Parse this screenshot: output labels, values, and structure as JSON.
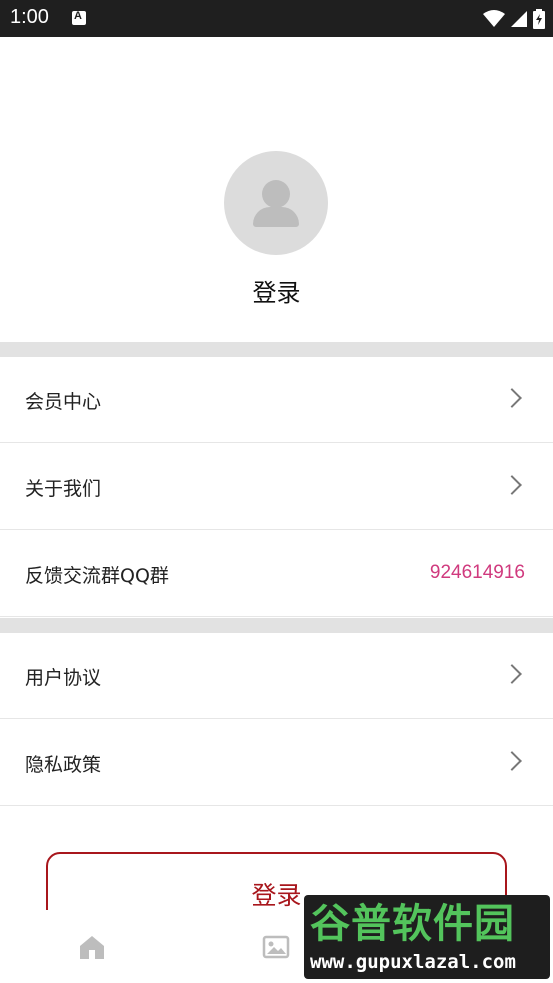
{
  "status_bar": {
    "time": "1:00"
  },
  "profile": {
    "login_text": "登录"
  },
  "menu_group_1": [
    {
      "label": "会员中心",
      "value": ""
    },
    {
      "label": "关于我们",
      "value": ""
    },
    {
      "label": "反馈交流群QQ群",
      "value": "924614916"
    }
  ],
  "menu_group_2": [
    {
      "label": "用户协议"
    },
    {
      "label": "隐私政策"
    }
  ],
  "login_button": {
    "label": "登录"
  },
  "tabs": [
    {
      "icon": "home-icon"
    },
    {
      "icon": "image-icon"
    },
    {
      "icon": "user-icon"
    }
  ],
  "watermark": {
    "title": "谷普软件园",
    "url": "www.gupuxlazal.com"
  },
  "colors": {
    "accent": "#a8161c",
    "qq_value": "#d03a7e",
    "divider": "#e2e2e2"
  }
}
